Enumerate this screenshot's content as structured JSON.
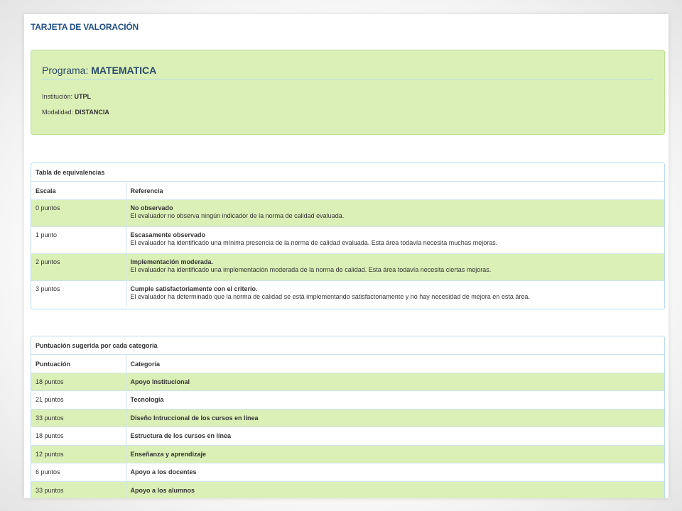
{
  "page": {
    "title": "TARJETA DE VALORACIÓN"
  },
  "program": {
    "label": "Programa:",
    "value": "MATEMATICA",
    "institution_label": "Institución:",
    "institution_value": "UTPL",
    "modality_label": "Modalidad:",
    "modality_value": "DISTANCIA"
  },
  "equivalences": {
    "title": "Tabla de equivalencias",
    "headers": [
      "Escala",
      "Referencia"
    ],
    "rows": [
      {
        "scale": "0 puntos",
        "label": "No observado",
        "desc": "El evaluador no observa ningún indicador de la norma de calidad evaluada."
      },
      {
        "scale": "1 punto",
        "label": "Escasamente observado",
        "desc": "El evaluador ha identificado una mínima presencia de la norma de calidad evaluada. Esta área todavía necesita muchas mejoras."
      },
      {
        "scale": "2 puntos",
        "label": "Implementación moderada.",
        "desc": "El evaluador ha identificado una implementación moderada de la norma de calidad. Esta área todavía necesita ciertas mejoras."
      },
      {
        "scale": "3 puntos",
        "label": "Cumple satisfactoriamente con el criterio.",
        "desc": "El evaluador ha determinado que la norma de calidad se está implementando satisfactoriamente y no hay necesidad de mejora en esta área."
      }
    ]
  },
  "scores": {
    "title": "Puntuación sugerida por cada categoría",
    "headers": [
      "Puntuación",
      "Categoría"
    ],
    "rows": [
      {
        "points": "18 puntos",
        "category": "Apoyo Institucional"
      },
      {
        "points": "21 puntos",
        "category": "Tecnología"
      },
      {
        "points": "33 puntos",
        "category": "Diseño Intruccional de los cursos en línea"
      },
      {
        "points": "18 puntos",
        "category": "Estructura de los cursos en línea"
      },
      {
        "points": "12 puntos",
        "category": "Enseñanza y aprendizaje"
      },
      {
        "points": "6 puntos",
        "category": "Apoyo a los docentes"
      },
      {
        "points": "33 puntos",
        "category": "Apoyo a los alumnos"
      }
    ]
  },
  "colors": {
    "title_blue": "#1f4f86",
    "row_green": "#dbf0b7",
    "border_blue": "#b9d9ec"
  }
}
